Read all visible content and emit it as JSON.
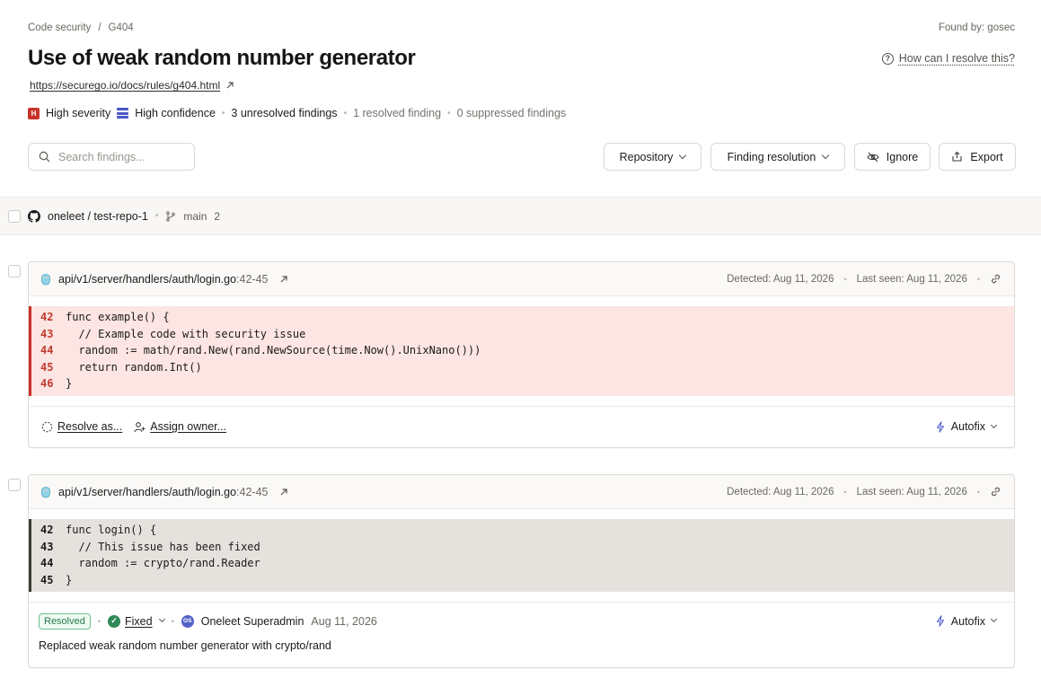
{
  "breadcrumb": {
    "section": "Code security",
    "separator": "/",
    "rule": "G404"
  },
  "found_by": "Found by: gosec",
  "title": "Use of weak random number generator",
  "help_link": "How can I resolve this?",
  "doc_link": "https://securego.io/docs/rules/g404.html",
  "meta": {
    "severity_icon": "H",
    "severity": "High severity",
    "confidence": "High confidence",
    "unresolved": "3 unresolved findings",
    "resolved": "1 resolved finding",
    "suppressed": "0 suppressed findings"
  },
  "search": {
    "placeholder": "Search findings..."
  },
  "toolbar": {
    "repository": "Repository",
    "finding_resolution": "Finding resolution",
    "ignore": "Ignore",
    "export": "Export"
  },
  "repo": {
    "name": "oneleet / test-repo-1",
    "branch": "main",
    "count": "2"
  },
  "findings": [
    {
      "path": "api/v1/server/handlers/auth/login.go",
      "lines": ":42-45",
      "detected": "Detected: Aug 11, 2026",
      "last_seen": "Last seen: Aug 11, 2026",
      "code": [
        {
          "ln": "42",
          "text": "func example() {"
        },
        {
          "ln": "43",
          "text": "  // Example code with security issue"
        },
        {
          "ln": "44",
          "text": "  random := math/rand.New(rand.NewSource(time.Now().UnixNano()))"
        },
        {
          "ln": "45",
          "text": "  return random.Int()"
        },
        {
          "ln": "46",
          "text": "}"
        }
      ],
      "resolve_as": "Resolve as...",
      "assign_owner": "Assign owner...",
      "autofix": "Autofix"
    },
    {
      "path": "api/v1/server/handlers/auth/login.go",
      "lines": ":42-45",
      "detected": "Detected: Aug 11, 2026",
      "last_seen": "Last seen: Aug 11, 2026",
      "code": [
        {
          "ln": "42",
          "text": "func login() {"
        },
        {
          "ln": "43",
          "text": "  // This issue has been fixed"
        },
        {
          "ln": "44",
          "text": "  random := crypto/rand.Reader"
        },
        {
          "ln": "45",
          "text": "}"
        }
      ],
      "status": "Resolved",
      "resolution": "Fixed",
      "user_initials": "OS",
      "user": "Oneleet Superadmin",
      "resolved_date": "Aug 11, 2026",
      "note": "Replaced weak random number generator with crypto/rand",
      "autofix": "Autofix"
    }
  ],
  "colors": {
    "severity": "#c8322a",
    "confidence": "#4a57c7",
    "vuln_bg": "#fce5e2",
    "fixed_bg": "#e5e2de",
    "resolved": "#2f8a57"
  }
}
